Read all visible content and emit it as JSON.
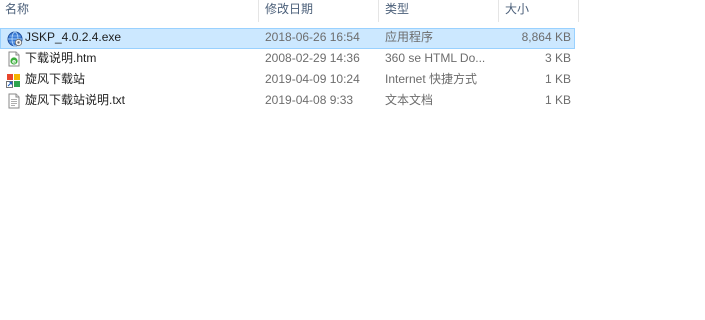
{
  "columns": {
    "name": "名称",
    "date": "修改日期",
    "type": "类型",
    "size": "大小"
  },
  "files": [
    {
      "name": "JSKP_4.0.2.4.exe",
      "date": "2018-06-26 16:54",
      "type": "应用程序",
      "size": "8,864 KB",
      "icon": "exe-globe-icon",
      "selected": true
    },
    {
      "name": "下载说明.htm",
      "date": "2008-02-29 14:36",
      "type": "360 se HTML Do...",
      "size": "3 KB",
      "icon": "html-document-icon",
      "selected": false
    },
    {
      "name": "旋风下载站",
      "date": "2019-04-09 10:24",
      "type": "Internet 快捷方式",
      "size": "1 KB",
      "icon": "internet-shortcut-icon",
      "selected": false
    },
    {
      "name": "旋风下载站说明.txt",
      "date": "2019-04-08 9:33",
      "type": "文本文档",
      "size": "1 KB",
      "icon": "text-file-icon",
      "selected": false
    }
  ],
  "colors": {
    "selection_bg": "#cce8ff",
    "selection_border": "#99d1ff",
    "header_text": "#4c607a"
  }
}
